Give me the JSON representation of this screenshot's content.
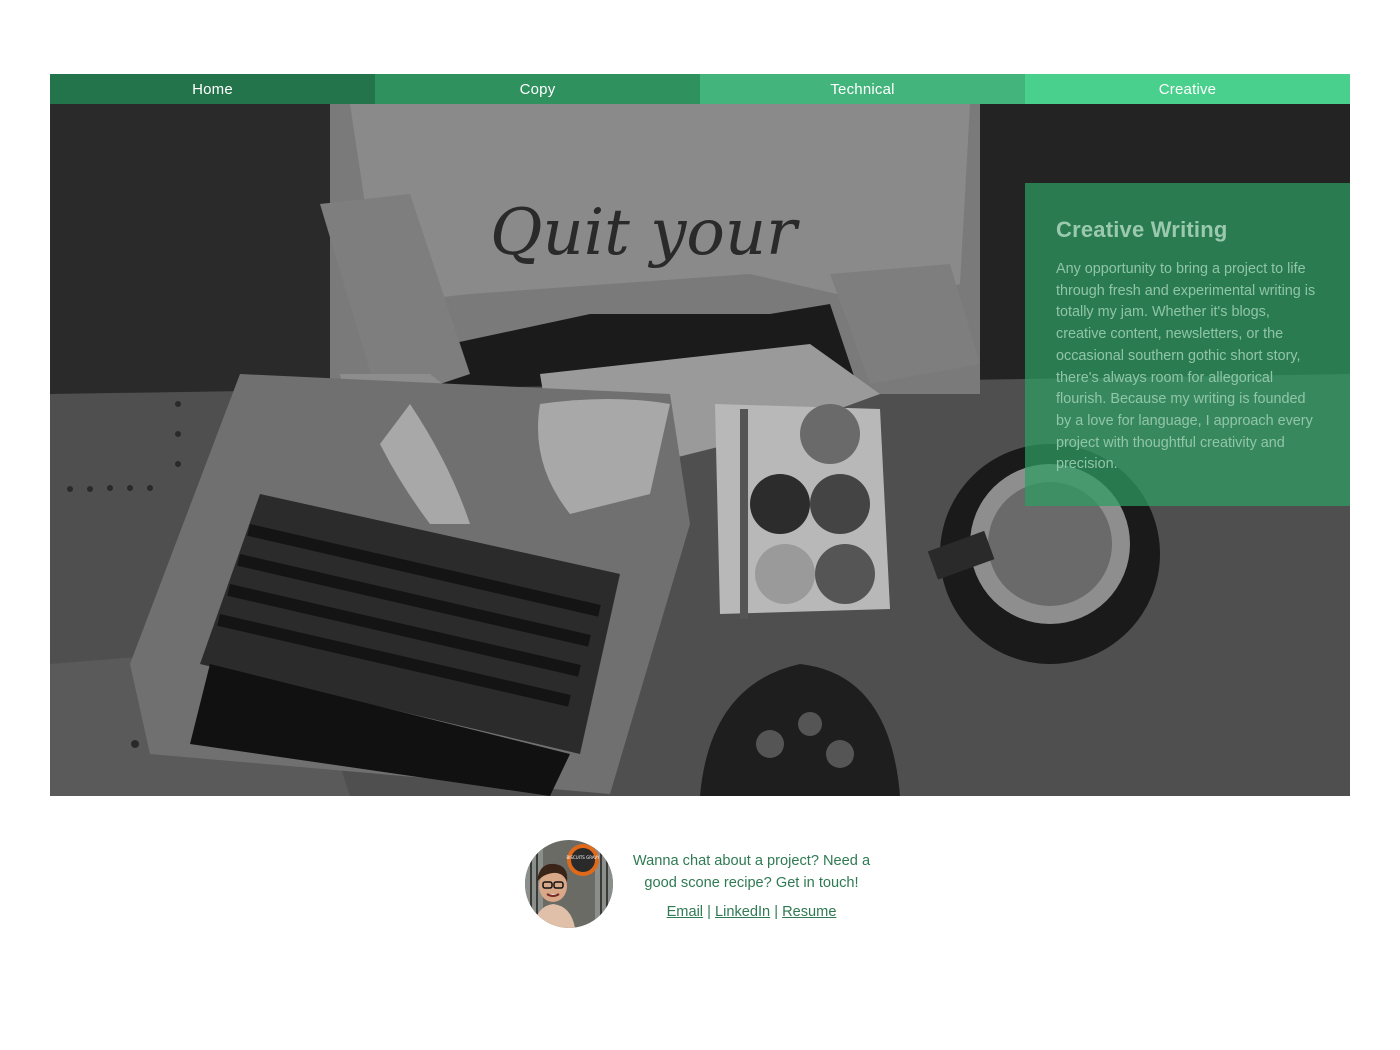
{
  "nav": {
    "items": [
      {
        "label": "Home"
      },
      {
        "label": "Copy"
      },
      {
        "label": "Technical"
      },
      {
        "label": "Creative"
      }
    ]
  },
  "hero": {
    "sweater_text": "Quit your"
  },
  "panel": {
    "title": "Creative Writing",
    "body": "Any opportunity to bring a project to life through fresh and experimental writing is totally my jam. Whether it's blogs, creative content, newsletters, or the occasional southern gothic short story, there's always room for allegorical flourish. Because my writing is founded by a love for language, I approach every project with thoughtful creativity and precision."
  },
  "footer": {
    "message": "Wanna chat about a project? Need a good scone recipe? Get in touch!",
    "links": {
      "email": "Email",
      "linkedin": "LinkedIn",
      "resume": "Resume",
      "separator": "|"
    },
    "avatar_sign": "BISCUITS GRAVY"
  },
  "colors": {
    "nav_home": "#23744a",
    "nav_copy": "#2e915e",
    "nav_technical": "#43b47b",
    "nav_creative": "#49d08c",
    "text_green": "#2f7a52"
  }
}
